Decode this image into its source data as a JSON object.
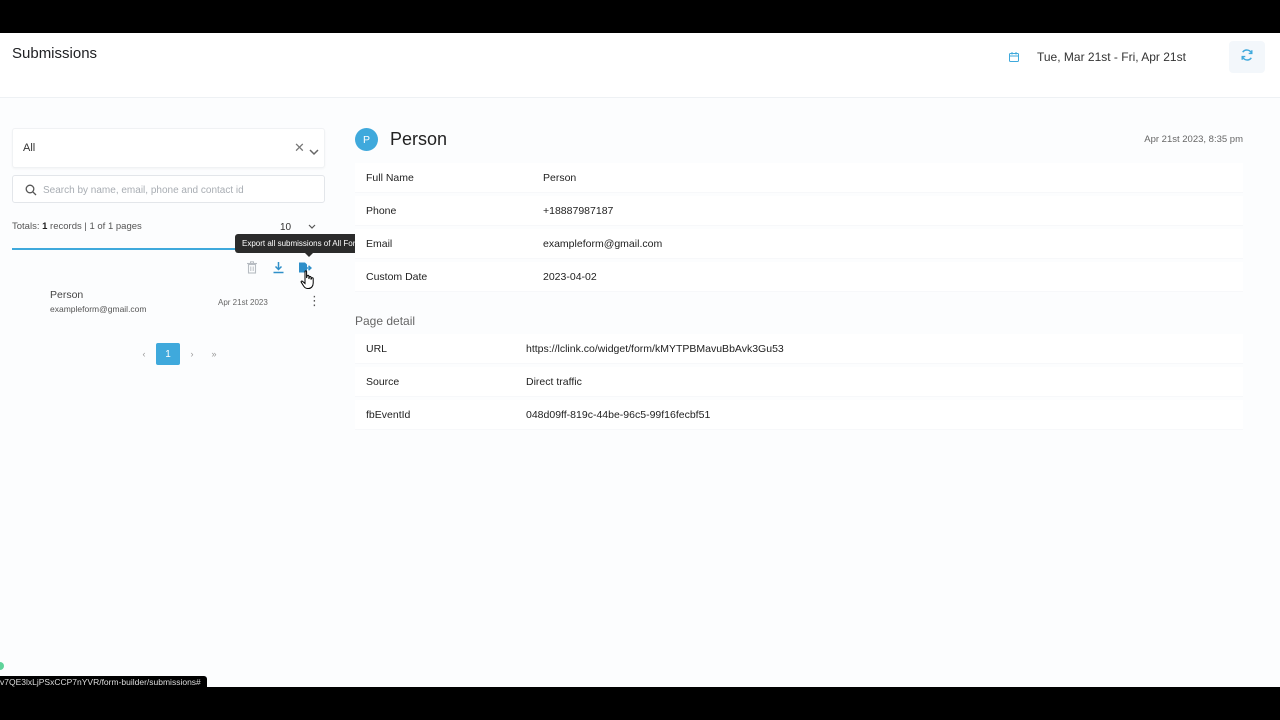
{
  "header": {
    "title": "Submissions",
    "date_range": "Tue, Mar 21st - Fri, Apr 21st"
  },
  "filter": {
    "form_selected": "All",
    "search_placeholder": "Search by name, email, phone and contact id"
  },
  "totals": {
    "prefix": "Totals:",
    "count": "1",
    "suffix": "records | 1 of 1 pages",
    "per_page": "10"
  },
  "tooltip": "Export all submissions of All Form",
  "submission": {
    "name": "Person",
    "email": "exampleform@gmail.com",
    "date": "Apr 21st 2023"
  },
  "pagination": {
    "prev": "‹",
    "current": "1",
    "next": "›",
    "last": "»"
  },
  "detail": {
    "avatar_letter": "P",
    "name": "Person",
    "timestamp": "Apr 21st 2023, 8:35 pm",
    "fields": [
      {
        "label": "Full Name",
        "value": "Person"
      },
      {
        "label": "Phone",
        "value": "+18887987187"
      },
      {
        "label": "Email",
        "value": "exampleform@gmail.com"
      },
      {
        "label": "Custom Date",
        "value": "2023-04-02"
      }
    ],
    "page_detail_title": "Page detail",
    "page_fields": [
      {
        "label": "URL",
        "value": "https://lclink.co/widget/form/kMYTPBMavuBbAvk3Gu53"
      },
      {
        "label": "Source",
        "value": "Direct traffic"
      },
      {
        "label": "fbEventId",
        "value": "048d09ff-819c-44be-96c5-99f16fecbf51"
      }
    ]
  },
  "status_bar_url": "v7QE3lxLjPSxCCP7nYVR/form-builder/submissions#",
  "colors": {
    "accent": "#3fa9dc",
    "tooltip_bg": "#2b2b2b"
  }
}
